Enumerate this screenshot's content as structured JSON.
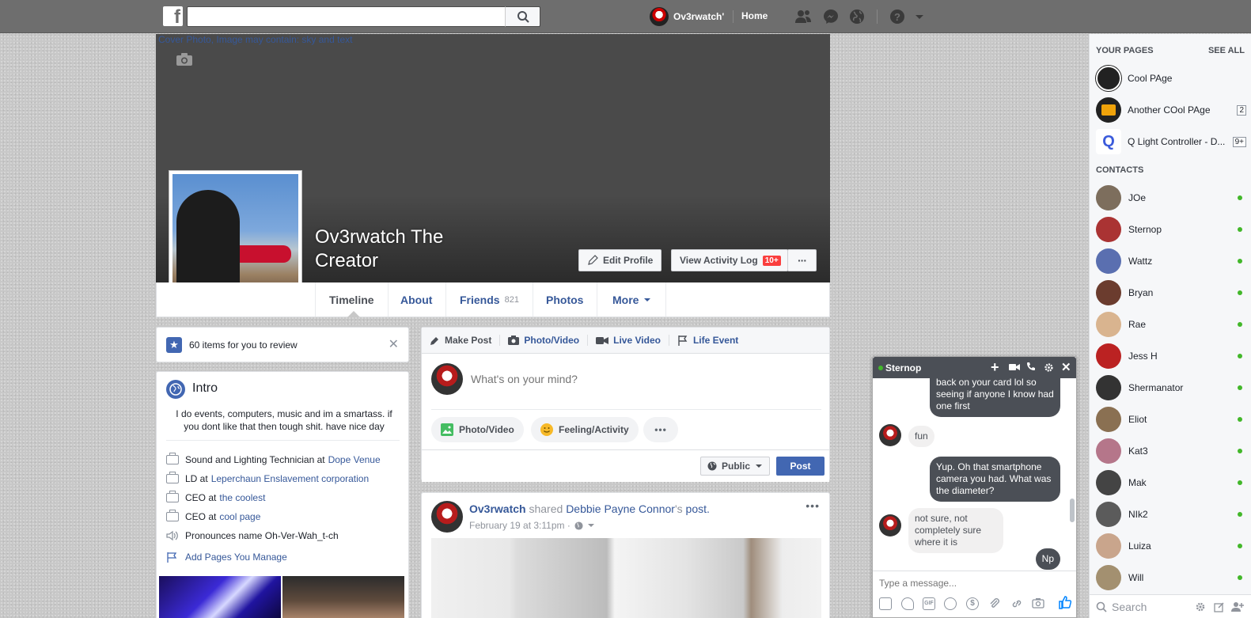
{
  "topbar": {
    "logo": "f",
    "search_placeholder": "",
    "user_name": "Ov3rwatch'",
    "home_label": "Home",
    "icons": [
      "friend-requests-icon",
      "messenger-icon",
      "notifications-globe-icon",
      "help-icon",
      "account-menu-icon"
    ]
  },
  "cover": {
    "alt_text": "Cover Photo, Image may contain: sky and text"
  },
  "profile": {
    "name": "Ov3rwatch The Creator",
    "edit_profile": "Edit Profile",
    "view_activity_log": "View Activity Log",
    "activity_badge": "10+",
    "more_dots": "···"
  },
  "tabs": [
    {
      "label": "Timeline"
    },
    {
      "label": "About"
    },
    {
      "label": "Friends",
      "count": "821"
    },
    {
      "label": "Photos"
    },
    {
      "label": "More"
    }
  ],
  "review": {
    "text": "60 items for you to review"
  },
  "intro": {
    "title": "Intro",
    "bio": "I do events, computers, music and im a smartass. if you dont like that then tough shit. have nice day",
    "items": [
      {
        "prefix": "Sound and Lighting Technician at",
        "link": "Dope Venue"
      },
      {
        "prefix": "LD at",
        "link": "Leperchaun Enslavement corporation"
      },
      {
        "prefix": "CEO at",
        "link": "the coolest"
      },
      {
        "prefix": "CEO at",
        "link": "cool page"
      }
    ],
    "pronounce": "Pronounces name Oh-Ver-Wah_t-ch",
    "add_pages": "Add Pages You Manage"
  },
  "composer": {
    "tabs": [
      "Make Post",
      "Photo/Video",
      "Live Video",
      "Life Event"
    ],
    "placeholder": "What's on your mind?",
    "photo_btn": "Photo/Video",
    "feeling_btn": "Feeling/Activity",
    "more": "•••",
    "audience": "Public",
    "post_btn": "Post"
  },
  "post": {
    "author": "Ov3rwatch",
    "shared": "shared",
    "target": "Debbie Payne Connor",
    "possessive": "'s",
    "object": "post.",
    "time": "February 19 at 3:11pm ·",
    "menu": "•••"
  },
  "sidebar": {
    "your_pages": "YOUR PAGES",
    "see_all": "SEE ALL",
    "pages": [
      {
        "name": "Cool PAge",
        "count": "",
        "color": "#222222"
      },
      {
        "name": "Another COol PAge",
        "count": "2",
        "color": "#f0a30a"
      },
      {
        "name": "Q Light Controller - D...",
        "count": "9+",
        "color": "#3b5bdb"
      }
    ],
    "contacts_title": "CONTACTS",
    "contacts": [
      {
        "name": "JOe",
        "color": "#7d6e5d"
      },
      {
        "name": "Sternop",
        "color": "#a33"
      },
      {
        "name": "Wattz",
        "color": "#5a6fb0"
      },
      {
        "name": "Bryan",
        "color": "#6b3c2e"
      },
      {
        "name": "Rae",
        "color": "#d9b48f"
      },
      {
        "name": "Jess H",
        "color": "#b22"
      },
      {
        "name": "Shermanator",
        "color": "#333"
      },
      {
        "name": "Eliot",
        "color": "#8a7052"
      },
      {
        "name": "Kat3",
        "color": "#b5768a"
      },
      {
        "name": "Mak",
        "color": "#444"
      },
      {
        "name": "NIk2",
        "color": "#5b5b5b"
      },
      {
        "name": "Luiza",
        "color": "#c9a58c"
      },
      {
        "name": "Will",
        "color": "#a39070"
      }
    ],
    "search_placeholder": "Search"
  },
  "chat": {
    "name": "Sternop",
    "messages": [
      {
        "from": "me",
        "text": "back on your card lol so seeing if anyone I know had one first"
      },
      {
        "from": "them",
        "text": "fun"
      },
      {
        "from": "me",
        "text": "Yup. Oh that smartphone camera you had. What was the diameter?"
      },
      {
        "from": "them",
        "text": "not sure, not completely sure where it is"
      },
      {
        "from": "me",
        "text": "Np"
      }
    ],
    "input_placeholder": "Type a message..."
  },
  "colors": {
    "topbar": "#6e6e6e",
    "link": "#365899",
    "online": "#42b72a",
    "badge": "#fa3e3e",
    "post_button": "#4267b2"
  }
}
